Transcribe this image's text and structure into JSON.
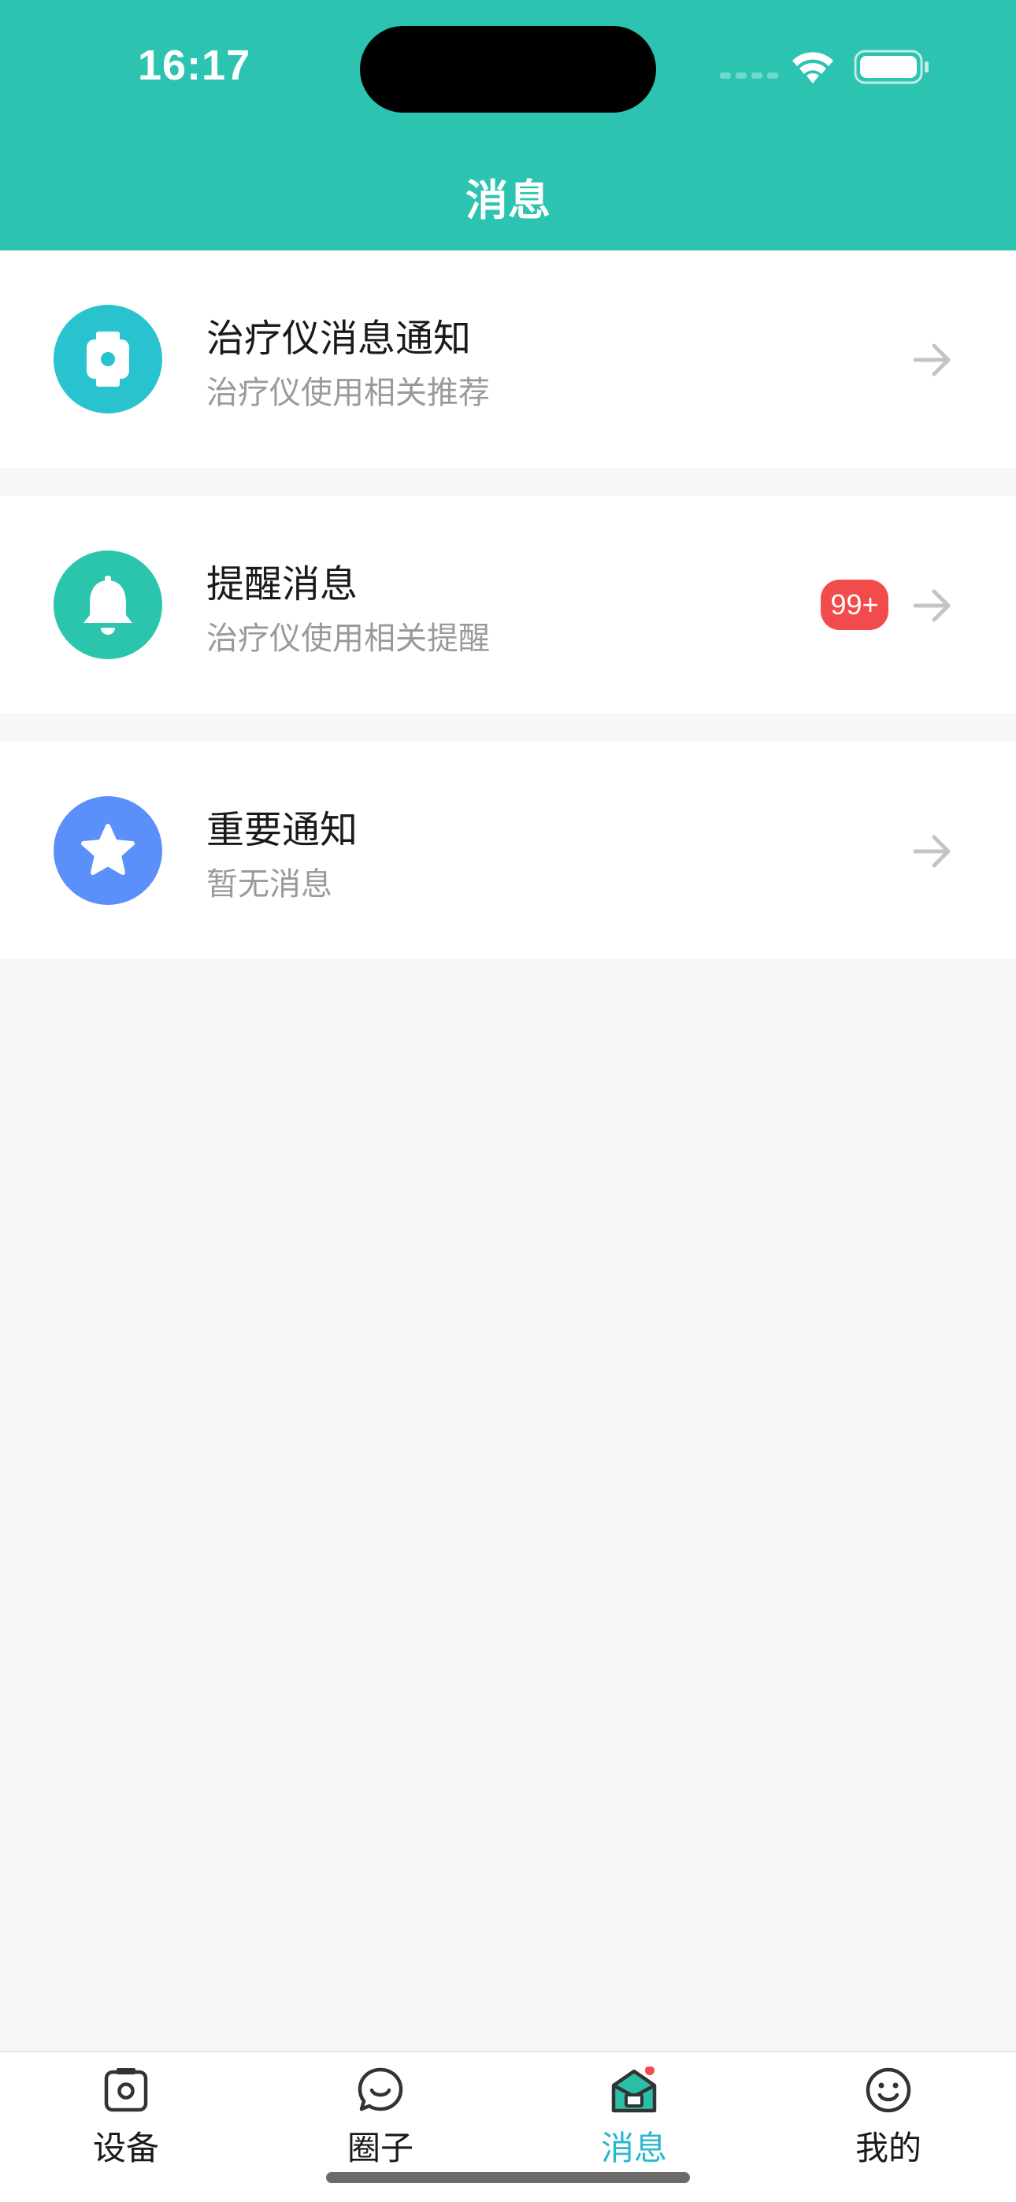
{
  "status_bar": {
    "time": "16:17"
  },
  "header": {
    "title": "消息"
  },
  "messages": [
    {
      "title": "治疗仪消息通知",
      "subtitle": "治疗仪使用相关推荐",
      "icon": "watch-icon",
      "icon_color": "#29c3cf"
    },
    {
      "title": "提醒消息",
      "subtitle": "治疗仪使用相关提醒",
      "icon": "bell-icon",
      "icon_color": "#2bc4ac",
      "badge": "99+"
    },
    {
      "title": "重要通知",
      "subtitle": "暂无消息",
      "icon": "star-icon",
      "icon_color": "#5b8ff9"
    }
  ],
  "tabbar": {
    "tabs": [
      {
        "label": "设备",
        "icon": "device-icon"
      },
      {
        "label": "圈子",
        "icon": "chat-icon"
      },
      {
        "label": "消息",
        "icon": "message-icon",
        "active": true
      },
      {
        "label": "我的",
        "icon": "smile-icon"
      }
    ]
  },
  "colors": {
    "header_bg": "#2cc4b0",
    "accent": "#29b8d0",
    "badge": "#f24b4b"
  }
}
